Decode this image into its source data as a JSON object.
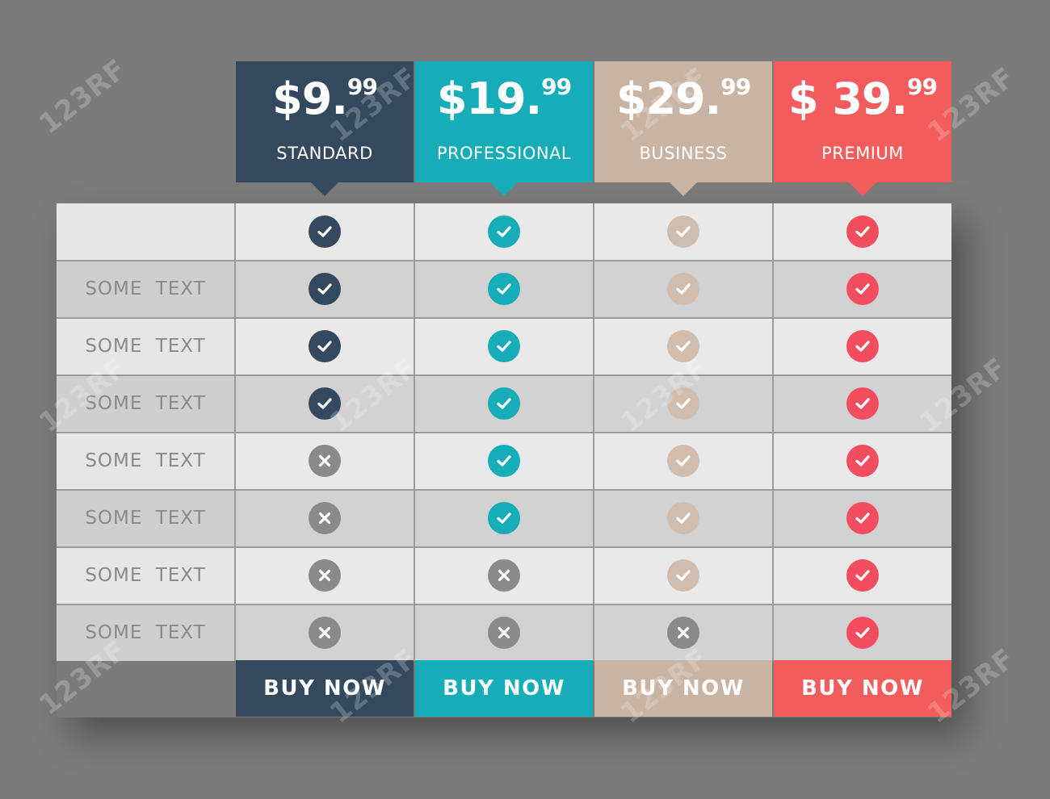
{
  "plans": [
    {
      "price_main": "$9.",
      "price_cents": "99",
      "name": "STANDARD",
      "color": "#34495e",
      "buy_label": "BUY NOW"
    },
    {
      "price_main": "$19.",
      "price_cents": "99",
      "name": "PROFESSIONAL",
      "color": "#16adb8",
      "buy_label": "BUY NOW"
    },
    {
      "price_main": "$29.",
      "price_cents": "99",
      "name": "BUSINESS",
      "color": "#c9b3a3",
      "buy_label": "BUY NOW"
    },
    {
      "price_main": "$ 39.",
      "price_cents": "99",
      "name": "PREMIUM",
      "color": "#f25c5c",
      "buy_label": "BUY NOW"
    }
  ],
  "features": [
    {
      "label": "",
      "included": [
        true,
        true,
        true,
        true
      ]
    },
    {
      "label": "SOME TEXT",
      "included": [
        true,
        true,
        true,
        true
      ]
    },
    {
      "label": "SOME TEXT",
      "included": [
        true,
        true,
        true,
        true
      ]
    },
    {
      "label": "SOME TEXT",
      "included": [
        true,
        true,
        true,
        true
      ]
    },
    {
      "label": "SOME TEXT",
      "included": [
        false,
        true,
        true,
        true
      ]
    },
    {
      "label": "SOME TEXT",
      "included": [
        false,
        true,
        true,
        true
      ]
    },
    {
      "label": "SOME TEXT",
      "included": [
        false,
        false,
        true,
        true
      ]
    },
    {
      "label": "SOME TEXT",
      "included": [
        false,
        false,
        false,
        true
      ]
    }
  ],
  "colors": {
    "background": "#7b7b7b",
    "row_light": "#e9e9e9",
    "row_dark": "#d2d2d2",
    "label_light": "#e6e6e6",
    "label_dark": "#cfcfcf",
    "excluded_icon": "#8a8a8a",
    "business_check": "#d1bdae",
    "premium_check": "#f24d5e"
  },
  "icons": {
    "included": "check-circle-icon",
    "excluded": "x-circle-icon"
  },
  "watermark": "123RF"
}
